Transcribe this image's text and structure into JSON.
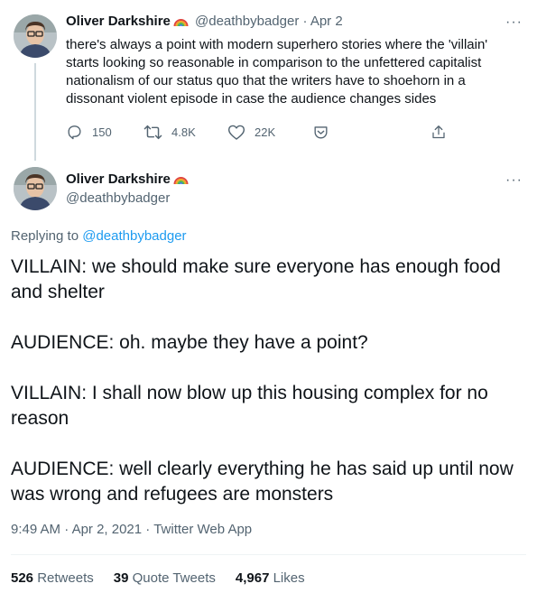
{
  "tweet1": {
    "author_name": "Oliver Darkshire",
    "handle": "@deathbybadger",
    "separator": "·",
    "date": "Apr 2",
    "text": "there's always a point with modern superhero stories where the 'villain' starts looking so reasonable in comparison to the unfettered capitalist nationalism of our status quo that the writers have to shoehorn in a dissonant violent episode in case the audience changes sides",
    "replies": "150",
    "retweets": "4.8K",
    "likes": "22K"
  },
  "tweet2": {
    "author_name": "Oliver Darkshire",
    "handle": "@deathbybadger",
    "replying_label": "Replying to",
    "replying_handle": "@deathbybadger",
    "paragraphs": [
      "VILLAIN: we should make sure everyone has enough food and shelter",
      "AUDIENCE: oh. maybe they have a point?",
      "VILLAIN: I shall now blow up this housing complex for no reason",
      "AUDIENCE: well clearly everything he has said up until now was wrong and refugees are monsters"
    ],
    "time": "9:49 AM",
    "date": "Apr 2, 2021",
    "source": "Twitter Web App",
    "sep": "·",
    "stats": {
      "retweets_count": "526",
      "retweets_label": "Retweets",
      "quotes_count": "39",
      "quotes_label": "Quote Tweets",
      "likes_count": "4,967",
      "likes_label": "Likes"
    }
  },
  "colors": {
    "link": "#1d9bf0",
    "muted": "#536471",
    "text": "#0f1419",
    "divider": "#eff3f4"
  },
  "icons": [
    "reply-icon",
    "retweet-icon",
    "like-icon",
    "tip-icon",
    "share-icon",
    "more-icon",
    "rainbow-emoji"
  ]
}
